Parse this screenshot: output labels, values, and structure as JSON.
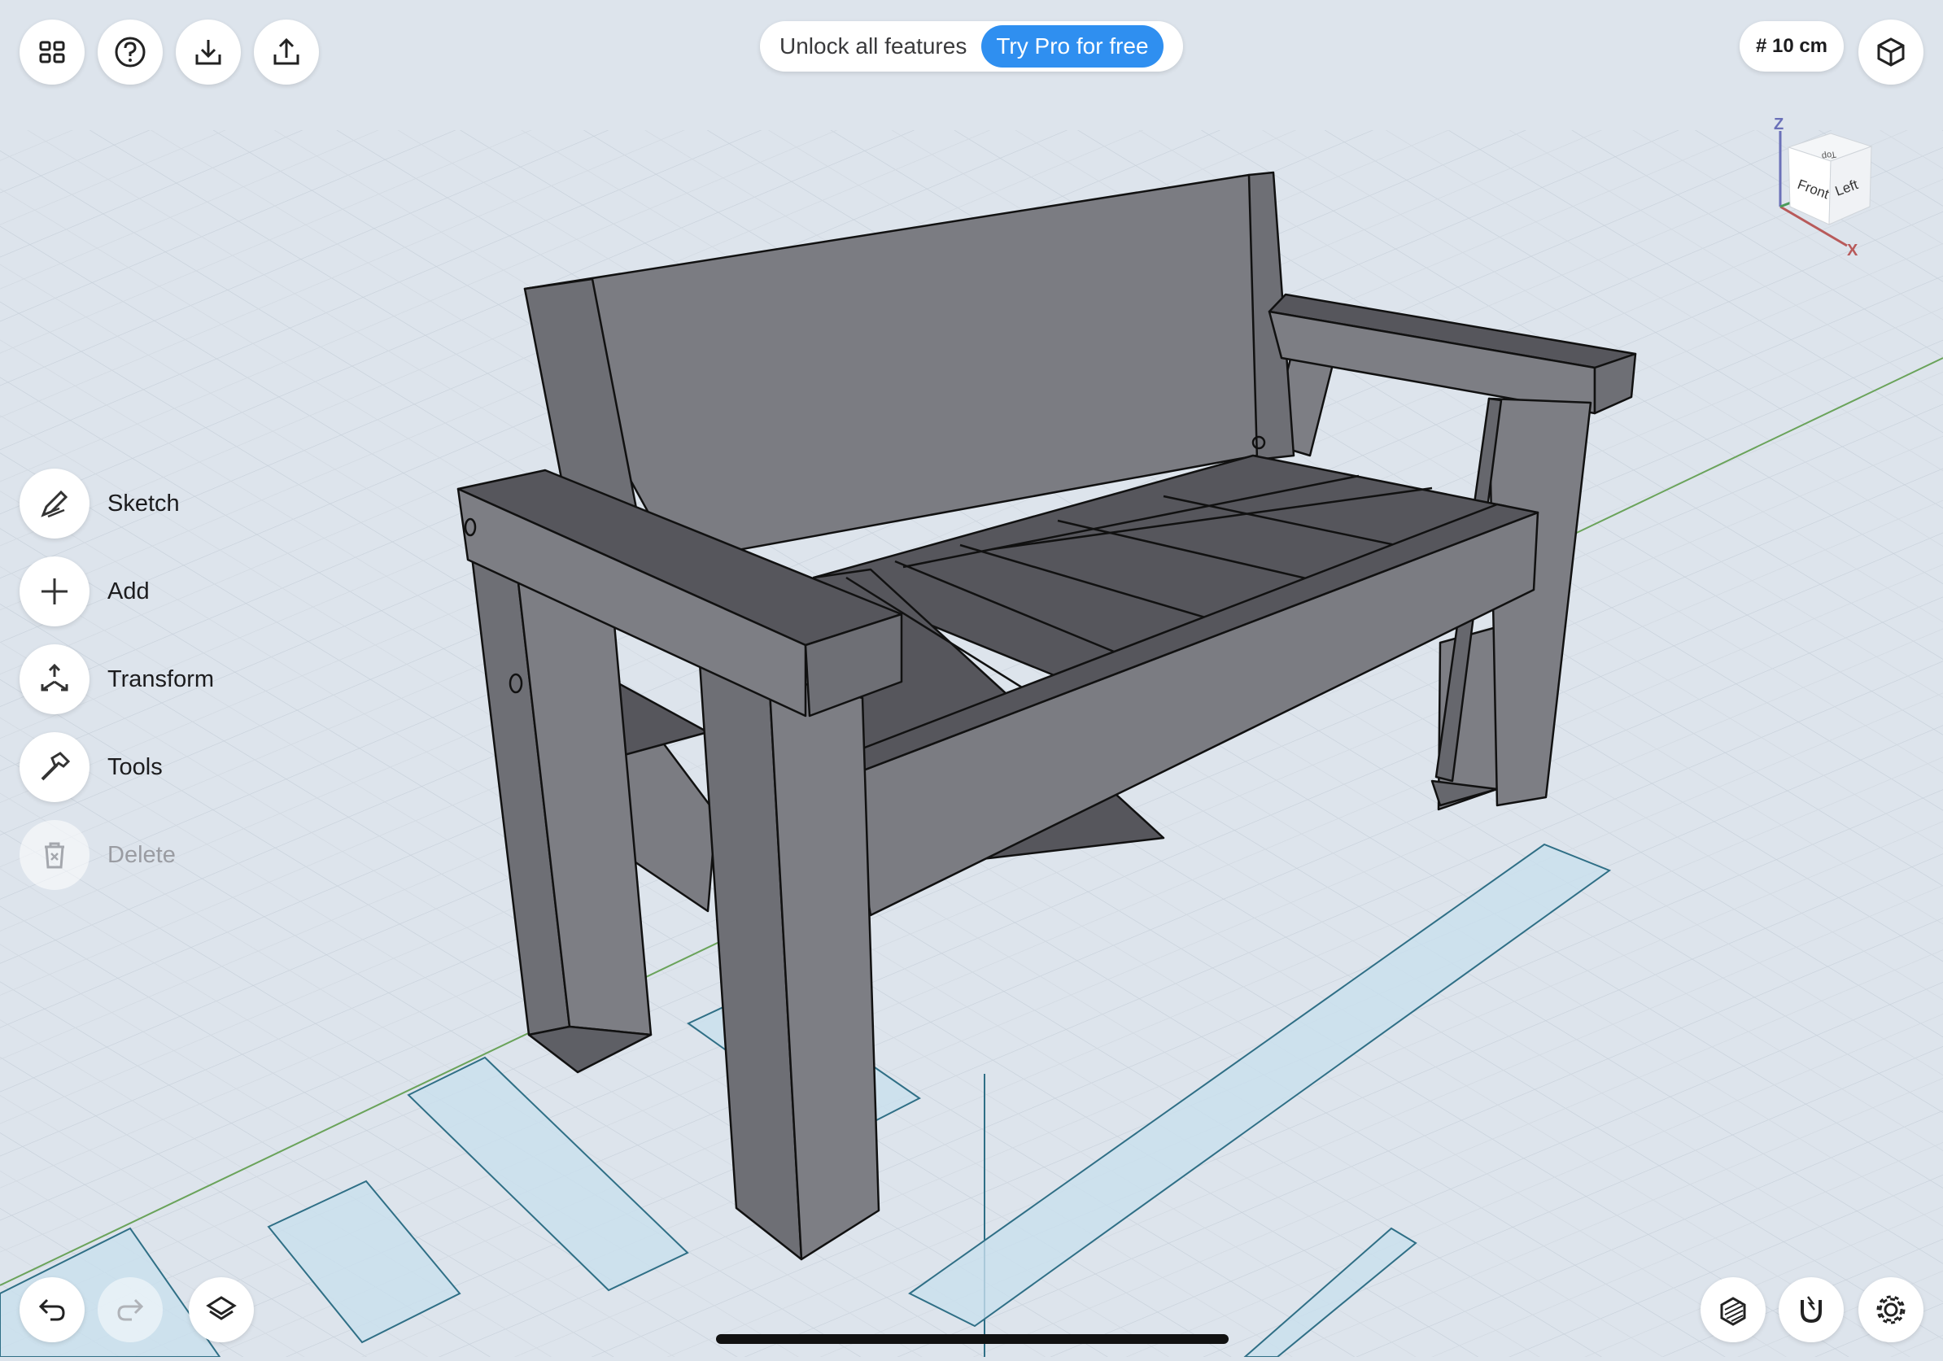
{
  "toolbar_top": {
    "promo_text": "Unlock all features",
    "promo_cta": "Try Pro for free",
    "grid_size": "# 10 cm"
  },
  "tools": [
    {
      "label": "Sketch",
      "icon": "pen-icon",
      "enabled": true
    },
    {
      "label": "Add",
      "icon": "plus-icon",
      "enabled": true
    },
    {
      "label": "Transform",
      "icon": "transform-arrows-icon",
      "enabled": true
    },
    {
      "label": "Tools",
      "icon": "hammer-icon",
      "enabled": true
    },
    {
      "label": "Delete",
      "icon": "trash-icon",
      "enabled": false
    }
  ],
  "view_cube": {
    "axis_z": "Z",
    "axis_x": "X",
    "face_front": "Front",
    "face_left": "Left",
    "face_top": "Top"
  },
  "colors": {
    "background": "#dde4ec",
    "accent": "#2f8ff0",
    "model_light": "#7d7e84",
    "model_dark": "#56565c",
    "footprint": "#c9e0ee",
    "axis_green": "#6aa35a"
  },
  "icons": {
    "top_left": [
      "grid-menu-icon",
      "help-icon",
      "import-icon",
      "export-icon"
    ],
    "top_right": [
      "view-mode-icon"
    ],
    "bottom_left": [
      "undo-icon",
      "redo-icon",
      "layers-icon"
    ],
    "bottom_right": [
      "section-icon",
      "snap-magnet-icon",
      "settings-icon"
    ]
  }
}
